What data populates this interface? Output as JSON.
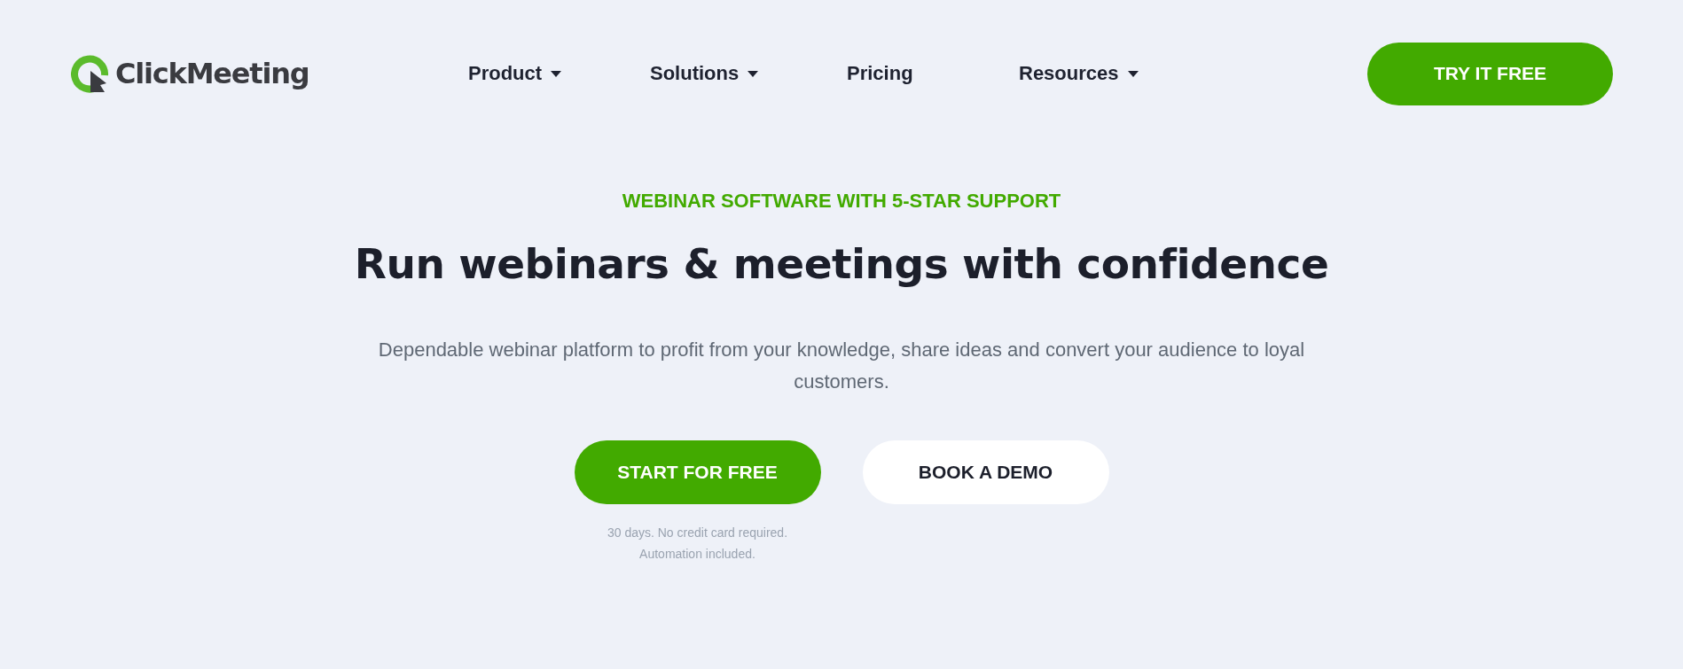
{
  "header": {
    "logo": "ClickMeeting",
    "nav": [
      {
        "label": "Product",
        "has_menu": true
      },
      {
        "label": "Solutions",
        "has_menu": true
      },
      {
        "label": "Pricing",
        "has_menu": false
      },
      {
        "label": "Resources",
        "has_menu": true
      }
    ],
    "cta": "TRY IT FREE"
  },
  "hero": {
    "kicker": "WEBINAR SOFTWARE WITH 5-STAR SUPPORT",
    "title": "Run webinars & meetings with confidence",
    "subtitle": "Dependable webinar platform to profit from your knowledge, share ideas and convert your audience to loyal customers.",
    "buttons": [
      {
        "label": "START FOR FREE",
        "kind": "primary"
      },
      {
        "label": "BOOK A DEMO",
        "kind": "secondary"
      }
    ],
    "note_lines": [
      "30 days. No credit card required.",
      "Automation included."
    ]
  }
}
